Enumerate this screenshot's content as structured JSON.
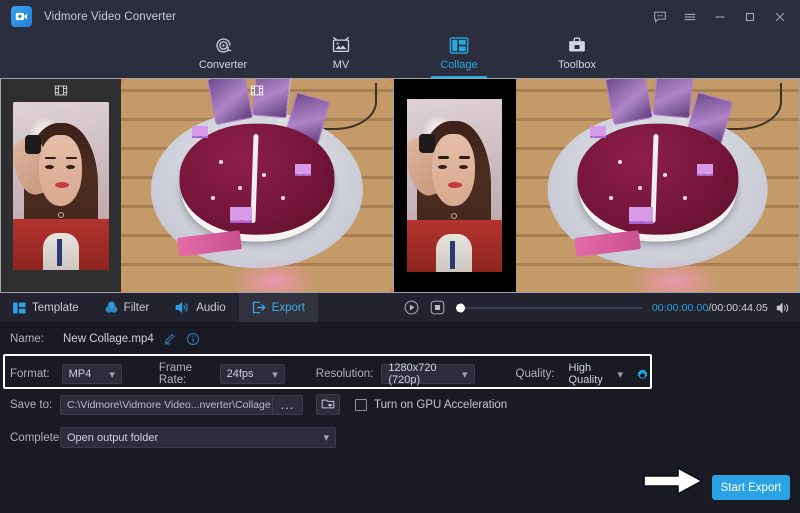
{
  "window": {
    "title": "Vidmore Video Converter",
    "logo_icon": "app-logo-icon",
    "controls": [
      {
        "name": "feedback-button",
        "icon": "speech-bubble-icon"
      },
      {
        "name": "menu-button",
        "icon": "hamburger-menu-icon"
      },
      {
        "name": "minimize-button",
        "icon": "minimize-icon"
      },
      {
        "name": "maximize-button",
        "icon": "maximize-icon"
      },
      {
        "name": "close-button",
        "icon": "close-icon"
      }
    ]
  },
  "nav": {
    "active": "Collage",
    "items": [
      {
        "label": "Converter",
        "icon": "converter-icon"
      },
      {
        "label": "MV",
        "icon": "mv-icon"
      },
      {
        "label": "Collage",
        "icon": "collage-icon"
      },
      {
        "label": "Toolbox",
        "icon": "toolbox-icon"
      }
    ]
  },
  "editor": {
    "cell_badge_icon": "film-strip-icon",
    "selected_cell": "cell-b"
  },
  "player": {
    "play_icon": "play-icon",
    "stop_icon": "stop-icon",
    "volume_icon": "volume-icon",
    "current_time": "00:00:00.00",
    "separator": "/",
    "total_time": "00:00:44.05",
    "progress_percent": 0
  },
  "edit_tabs": {
    "active": "Export",
    "items": [
      {
        "label": "Template",
        "icon": "template-icon"
      },
      {
        "label": "Filter",
        "icon": "filter-icon"
      },
      {
        "label": "Audio",
        "icon": "audio-icon"
      },
      {
        "label": "Export",
        "icon": "export-icon"
      }
    ]
  },
  "export": {
    "name_label": "Name:",
    "name_value": "New Collage.mp4",
    "edit_icon": "pencil-icon",
    "info_icon": "info-icon",
    "format_label": "Format:",
    "format_value": "MP4",
    "framerate_label": "Frame Rate:",
    "framerate_value": "24fps",
    "resolution_label": "Resolution:",
    "resolution_value": "1280x720 (720p)",
    "quality_label": "Quality:",
    "quality_value": "High Quality",
    "settings_icon": "gear-icon",
    "save_label": "Save to:",
    "save_path": "C:\\Vidmore\\Vidmore Video...nverter\\Collage Exported",
    "browse_label": "...",
    "folder_icon": "folder-icon",
    "gpu_label": "Turn on GPU Acceleration",
    "gpu_checked": false,
    "complete_label": "Complete:",
    "complete_value": "Open output folder",
    "start_export_label": "Start Export",
    "pointer_icon": "right-arrow-annotation"
  },
  "colors": {
    "accent": "#2aa3e6",
    "titlebar": "#2b2e3d",
    "panel_bg": "#1a1a24",
    "selection_border": "#e8622a",
    "highlight_border": "#ffffff"
  }
}
